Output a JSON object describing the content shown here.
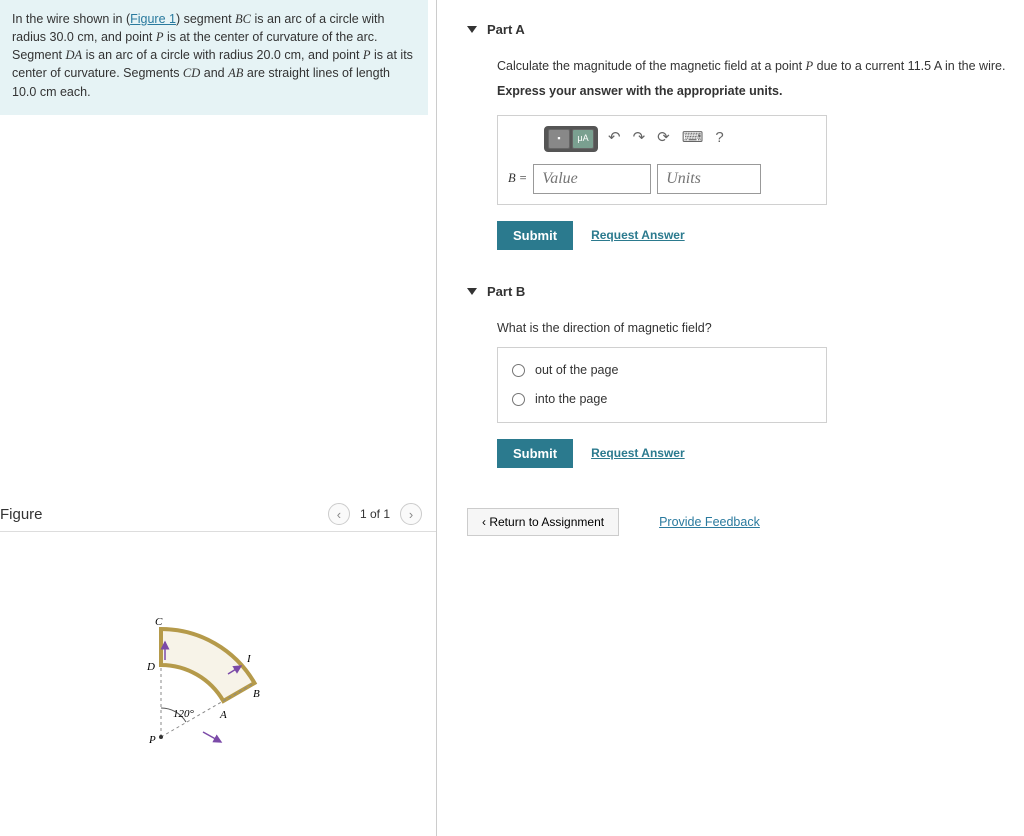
{
  "problem": {
    "text_parts": {
      "t1": "In the wire shown in (",
      "link": "Figure 1",
      "t2": ") segment ",
      "bc": "BC",
      "t3": " is an arc of a circle with radius 30.0 ",
      "cm1": "cm",
      "t4": ", and point ",
      "p1": "P",
      "t5": " is at the center of curvature of the arc. Segment ",
      "da": "DA",
      "t6": " is an arc of a circle with radius 20.0 ",
      "cm2": "cm",
      "t7": ", and point ",
      "p2": "P",
      "t8": " is at its center of curvature. Segments ",
      "cd": "CD",
      "t9": " and ",
      "ab": "AB",
      "t10": " are straight lines of length 10.0 ",
      "cm3": "cm",
      "t11": " each."
    }
  },
  "figure": {
    "title": "Figure",
    "pager": "1 of 1",
    "labels": {
      "C": "C",
      "D": "D",
      "B": "B",
      "A": "A",
      "P": "P",
      "I": "I",
      "angle": "120°"
    }
  },
  "partA": {
    "title": "Part A",
    "prompt_pre": "Calculate the magnitude of the magnetic field at a point ",
    "prompt_P": "P",
    "prompt_mid": " due to a current 11.5 ",
    "prompt_A": "A",
    "prompt_post": " in the wire.",
    "instruction": "Express your answer with the appropriate units.",
    "toolbar": {
      "muA": "μA",
      "help": "?"
    },
    "eq_label": "B = ",
    "value_placeholder": "Value",
    "units_placeholder": "Units",
    "submit": "Submit",
    "request": "Request Answer"
  },
  "partB": {
    "title": "Part B",
    "prompt": "What is the direction of magnetic field?",
    "option1": "out of the page",
    "option2": "into the page",
    "submit": "Submit",
    "request": "Request Answer"
  },
  "footer": {
    "return": "Return to Assignment",
    "feedback": "Provide Feedback"
  }
}
